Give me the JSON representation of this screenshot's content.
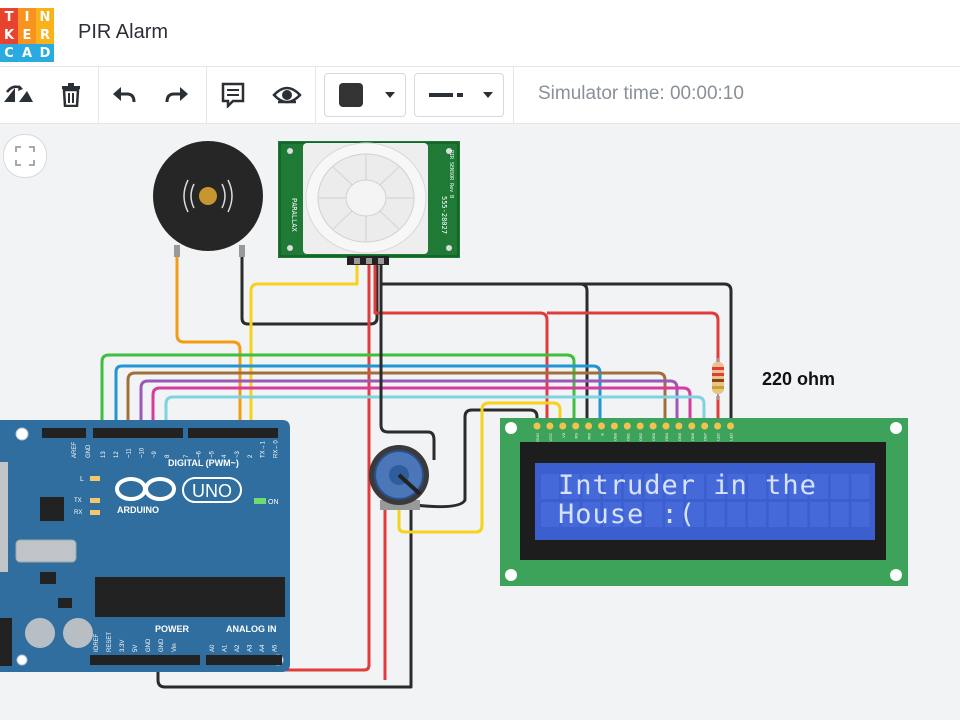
{
  "app": {
    "logo_letters": [
      "T",
      "I",
      "N",
      "K",
      "E",
      "R",
      "C",
      "A",
      "D"
    ],
    "logo_colors": [
      "#e8432f",
      "#f7931e",
      "#f9b21a",
      "#e8432f",
      "#f7931e",
      "#f9b21a",
      "#29abe2",
      "#29abe2",
      "#29abe2"
    ],
    "title": "PIR Alarm"
  },
  "toolbar": {
    "simulator_time": "Simulator time: 00:00:10",
    "icons": [
      "rotate-icon",
      "trash-icon",
      "undo-icon",
      "redo-icon",
      "note-icon",
      "eye-icon"
    ],
    "color_value": "#333333"
  },
  "circuit": {
    "resistor_label": "220 ohm",
    "lcd_line1": "Intruder in the",
    "lcd_line2": "House :(",
    "arduino_brand": "ARDUINO",
    "arduino_model": "UNO",
    "digital_label": "DIGITAL (PWM~)",
    "power_label": "POWER",
    "analog_label": "ANALOG IN",
    "on_label": "ON",
    "aref": "AREF",
    "gnd": "GND",
    "tx_label": "TX",
    "rx_label": "RX",
    "l_label": "L",
    "digital_pins": [
      "13",
      "12",
      "~11",
      "~10",
      "~9",
      "8",
      "7",
      "~6",
      "~5",
      "4",
      "~3",
      "2",
      "TX→1",
      "RX←0"
    ],
    "power_pins": [
      "IOREF",
      "RESET",
      "3.3V",
      "5V",
      "GND",
      "GND",
      "Vin"
    ],
    "analog_pins": [
      "A0",
      "A1",
      "A2",
      "A3",
      "A4",
      "A5"
    ],
    "pir_text_left": "PARALLAX",
    "pir_text_right": "555-28027",
    "pir_text_top": "PIR SENSOR Rev B",
    "lcd_pins": [
      "GND",
      "VCC",
      "V0",
      "RS",
      "RW",
      "E",
      "DB0",
      "DB1",
      "DB2",
      "DB3",
      "DB4",
      "DB5",
      "DB6",
      "DB7",
      "LED",
      "LED"
    ]
  }
}
